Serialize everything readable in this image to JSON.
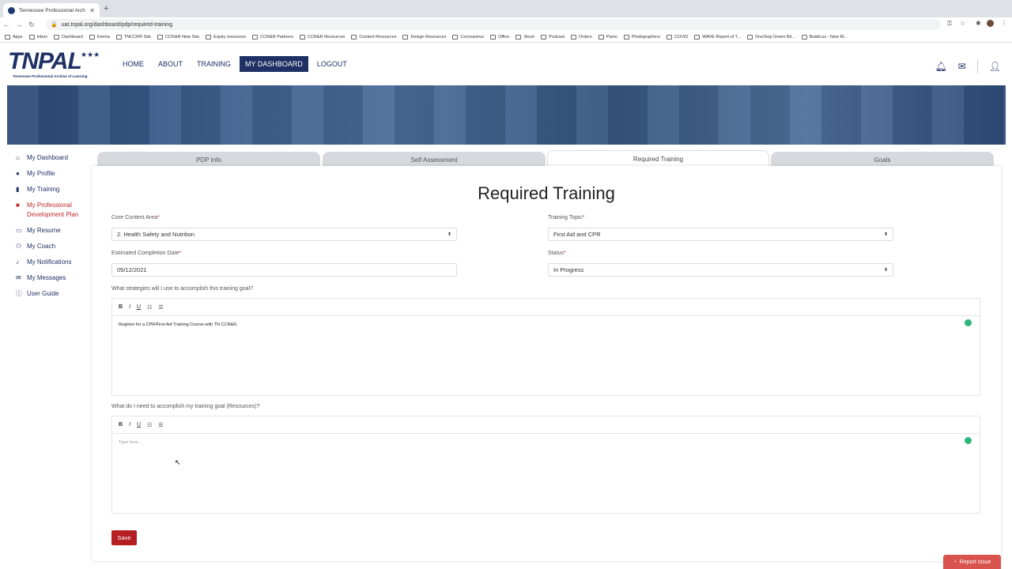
{
  "browser": {
    "tab_title": "Tennessee Professional Archiv...",
    "url": "uat.tnpal.org/dashboard/pdp/required-training",
    "bookmarks": [
      "Apps",
      "Inbox",
      "Dashboard",
      "Emma",
      "TNCCRR Site",
      "CCR&R New Site",
      "Equity resources",
      "CCR&R Partners",
      "CCR&R Resources",
      "Content Resources",
      "Design Resources",
      "Coronavirus",
      "Office",
      "Stock",
      "Podcast",
      "Orders",
      "Piano",
      "Photographers",
      "COVID",
      "WAVE Report of T...",
      "OneStop Green Bil...",
      "Bubbl.us - New M..."
    ]
  },
  "site": {
    "logo_text": "TNPAL",
    "logo_tagline": "Tennessee Professional Archive of Learning",
    "nav": [
      "HOME",
      "ABOUT",
      "TRAINING",
      "MY DASHBOARD",
      "LOGOUT"
    ]
  },
  "sidebar": {
    "items": [
      {
        "label": "My Dashboard",
        "icon": "home-icon"
      },
      {
        "label": "My Profile",
        "icon": "user-icon"
      },
      {
        "label": "My Training",
        "icon": "book-icon"
      },
      {
        "label": "My Professional Development Plan",
        "icon": "briefcase-icon"
      },
      {
        "label": "My Resume",
        "icon": "id-card-icon"
      },
      {
        "label": "My Coach",
        "icon": "coach-icon"
      },
      {
        "label": "My Notifications",
        "icon": "bell-icon"
      },
      {
        "label": "My Messages",
        "icon": "envelope-icon"
      },
      {
        "label": "User Guide",
        "icon": "info-icon"
      }
    ]
  },
  "tabs": [
    "PDP Info",
    "Self Assessment",
    "Required Training",
    "Goals"
  ],
  "form": {
    "title": "Required Training",
    "core_content_label": "Core Content Area",
    "core_content_value": "2. Health Safety and Nutrition",
    "training_topic_label": "Training Topic",
    "training_topic_value": "First Aid and CPR",
    "completion_date_label": "Estimated Completion Date",
    "completion_date_value": "05/12/2021",
    "status_label": "Status",
    "status_value": "In Progress",
    "strategies_label": "What strategies will I use to accomplish this training goal?",
    "strategies_value": "Register for a CPR/First Aid Training Course with TN CCR&R.",
    "resources_label": "What do I need to accomplish my training goal (Resources)?",
    "resources_placeholder": "Type here...",
    "required_marker": "*",
    "toolbar": {
      "bold": "B",
      "italic": "I",
      "underline": "U"
    },
    "save_label": "Save"
  },
  "report_issue_label": "Report Issue"
}
